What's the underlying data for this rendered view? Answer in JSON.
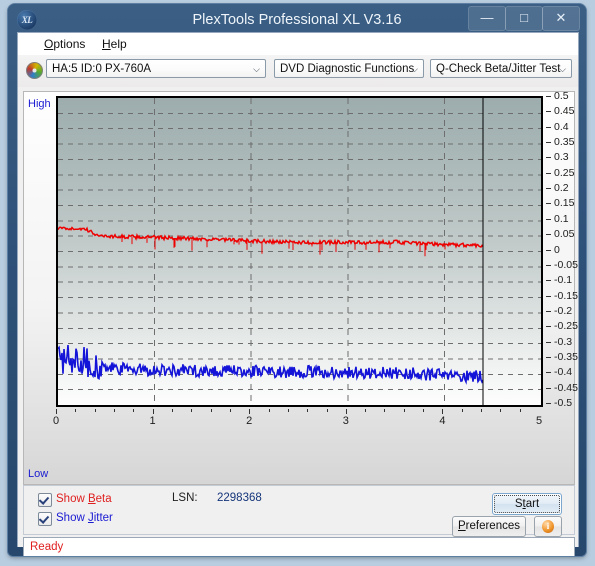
{
  "window": {
    "title": "PlexTools Professional XL V3.16",
    "logo_text": "XL",
    "buttons": {
      "minimize": "—",
      "maximize": "□",
      "close": "✕"
    }
  },
  "menubar": {
    "items": [
      {
        "label": "Options",
        "mnemonic": "O"
      },
      {
        "label": "Help",
        "mnemonic": "H"
      }
    ]
  },
  "toolbar": {
    "drive": "HA:5 ID:0  PX-760A",
    "function": "DVD Diagnostic Functions",
    "test": "Q-Check Beta/Jitter Test",
    "arrow": "⌵"
  },
  "chart_panel": {
    "high_label": "High",
    "low_label": "Low"
  },
  "options": {
    "show_beta_label": "Show Beta",
    "show_beta_mnemonic": "B",
    "show_beta_checked": true,
    "show_jitter_label": "Show Jitter",
    "show_jitter_mnemonic": "J",
    "show_jitter_checked": true,
    "lsn_label": "LSN:",
    "lsn_value": "2298368",
    "start_label": "Start",
    "start_mnemonic": "S",
    "preferences_label": "Preferences",
    "preferences_mnemonic": "P",
    "info_glyph": "i"
  },
  "statusbar": {
    "text": "Ready"
  },
  "colors": {
    "beta": "#ee0000",
    "jitter": "#1414d8",
    "title_bar": "#2e5179",
    "status_text": "#e02020",
    "axis_label": "#1b1bd2"
  },
  "chart_data": {
    "type": "line",
    "title": "Q-Check Beta/Jitter Test",
    "xlabel": "",
    "ylabel": "",
    "xlim": [
      0,
      5
    ],
    "ylim": [
      -0.5,
      0.5
    ],
    "grid": true,
    "legend": [
      "Show Beta",
      "Show Jitter"
    ],
    "legend_position": "bottom-left",
    "x_ticks": [
      0,
      1,
      2,
      3,
      4,
      5
    ],
    "y_ticks": [
      0.5,
      0.45,
      0.4,
      0.35,
      0.3,
      0.25,
      0.2,
      0.15,
      0.1,
      0.05,
      0,
      -0.05,
      -0.1,
      -0.15,
      -0.2,
      -0.25,
      -0.3,
      -0.35,
      -0.4,
      -0.45,
      -0.5
    ],
    "data_end_x": 4.4,
    "axis_annotations": {
      "top": "High",
      "bottom": "Low"
    },
    "series": [
      {
        "name": "Beta",
        "color": "#ee0000",
        "x": [
          0.0,
          0.05,
          0.1,
          0.15,
          0.2,
          0.25,
          0.3,
          0.35,
          0.4,
          0.45,
          0.5,
          0.6,
          0.7,
          0.8,
          0.9,
          1.0,
          1.1,
          1.2,
          1.3,
          1.4,
          1.5,
          1.6,
          1.7,
          1.8,
          1.9,
          2.0,
          2.1,
          2.2,
          2.3,
          2.4,
          2.5,
          2.6,
          2.7,
          2.8,
          2.9,
          3.0,
          3.1,
          3.2,
          3.3,
          3.4,
          3.5,
          3.6,
          3.7,
          3.8,
          3.9,
          4.0,
          4.1,
          4.2,
          4.3,
          4.4
        ],
        "values": [
          0.075,
          0.076,
          0.075,
          0.074,
          0.075,
          0.073,
          0.07,
          0.062,
          0.055,
          0.052,
          0.05,
          0.049,
          0.048,
          0.047,
          0.047,
          0.046,
          0.045,
          0.044,
          0.043,
          0.042,
          0.041,
          0.039,
          0.038,
          0.037,
          0.036,
          0.034,
          0.033,
          0.032,
          0.031,
          0.03,
          0.03,
          0.029,
          0.029,
          0.03,
          0.031,
          0.03,
          0.029,
          0.028,
          0.029,
          0.03,
          0.031,
          0.029,
          0.027,
          0.025,
          0.024,
          0.023,
          0.022,
          0.021,
          0.021,
          0.02
        ],
        "noise": 0.006
      },
      {
        "name": "Jitter",
        "color": "#1414d8",
        "x": [
          0.0,
          0.05,
          0.1,
          0.15,
          0.2,
          0.25,
          0.3,
          0.35,
          0.4,
          0.45,
          0.5,
          0.6,
          0.7,
          0.8,
          0.9,
          1.0,
          1.1,
          1.2,
          1.3,
          1.4,
          1.5,
          1.6,
          1.7,
          1.8,
          1.9,
          2.0,
          2.1,
          2.2,
          2.3,
          2.4,
          2.5,
          2.6,
          2.7,
          2.8,
          2.9,
          3.0,
          3.1,
          3.2,
          3.3,
          3.4,
          3.5,
          3.6,
          3.7,
          3.8,
          3.9,
          4.0,
          4.1,
          4.2,
          4.3,
          4.4
        ],
        "values": [
          -0.355,
          -0.35,
          -0.345,
          -0.352,
          -0.348,
          -0.35,
          -0.358,
          -0.368,
          -0.375,
          -0.378,
          -0.38,
          -0.382,
          -0.383,
          -0.384,
          -0.385,
          -0.386,
          -0.386,
          -0.387,
          -0.387,
          -0.388,
          -0.388,
          -0.389,
          -0.389,
          -0.39,
          -0.39,
          -0.39,
          -0.391,
          -0.391,
          -0.391,
          -0.392,
          -0.392,
          -0.392,
          -0.393,
          -0.393,
          -0.394,
          -0.394,
          -0.394,
          -0.395,
          -0.395,
          -0.396,
          -0.396,
          -0.397,
          -0.398,
          -0.4,
          -0.402,
          -0.404,
          -0.406,
          -0.407,
          -0.406,
          -0.405
        ],
        "noise": 0.02
      }
    ]
  }
}
